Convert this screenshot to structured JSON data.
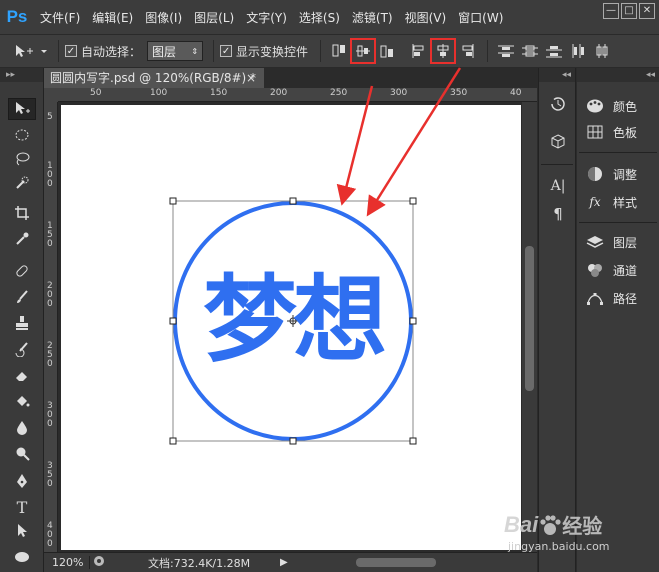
{
  "app": {
    "logo": "Ps",
    "menu": [
      "文件(F)",
      "编辑(E)",
      "图像(I)",
      "图层(L)",
      "文字(Y)",
      "选择(S)",
      "滤镜(T)",
      "视图(V)",
      "窗口(W)"
    ],
    "window_controls": [
      "—",
      "□",
      "✕"
    ]
  },
  "options_bar": {
    "auto_select_label": "自动选择：",
    "auto_select_checked": true,
    "auto_select_target": "图层",
    "show_transform_label": "显示变换控件",
    "show_transform_checked": true,
    "highlighted_buttons": [
      "align-horizontal-centers",
      "align-vertical-centers"
    ],
    "highlight_color": "#e8302d"
  },
  "document": {
    "tab_title": "圆圆内写字.psd @ 120%(RGB/8#) *",
    "tab_close": "×",
    "ruler_h_labels": [
      "50",
      "100",
      "150",
      "200",
      "250",
      "300",
      "350",
      "40"
    ],
    "ruler_v_labels": [
      "5",
      "1 0 0",
      "1 5 0",
      "2 0 0",
      "2 5 0",
      "3 0 0",
      "3 5 0",
      "4 0 0"
    ],
    "canvas_text": "梦想",
    "circle_color": "#2f6ff0",
    "text_color": "#2f6ff0",
    "zoom": "120%",
    "doc_info": "文档:732.4K/1.28M",
    "status_arrow": "▶"
  },
  "panels_narrow": {
    "collapse": "◂◂"
  },
  "panels_wide": {
    "collapse": "◂◂",
    "items": [
      {
        "label": "颜色",
        "icon": "palette-icon"
      },
      {
        "label": "色板",
        "icon": "swatches-icon"
      },
      {
        "label": "调整",
        "icon": "adjustments-icon"
      },
      {
        "label": "样式",
        "icon": "styles-icon"
      },
      {
        "label": "图层",
        "icon": "layers-icon"
      },
      {
        "label": "通道",
        "icon": "channels-icon"
      },
      {
        "label": "路径",
        "icon": "paths-icon"
      }
    ]
  },
  "watermark": {
    "brand": "Bai",
    "brand2": "经验",
    "url": "jingyan.baidu.com"
  }
}
